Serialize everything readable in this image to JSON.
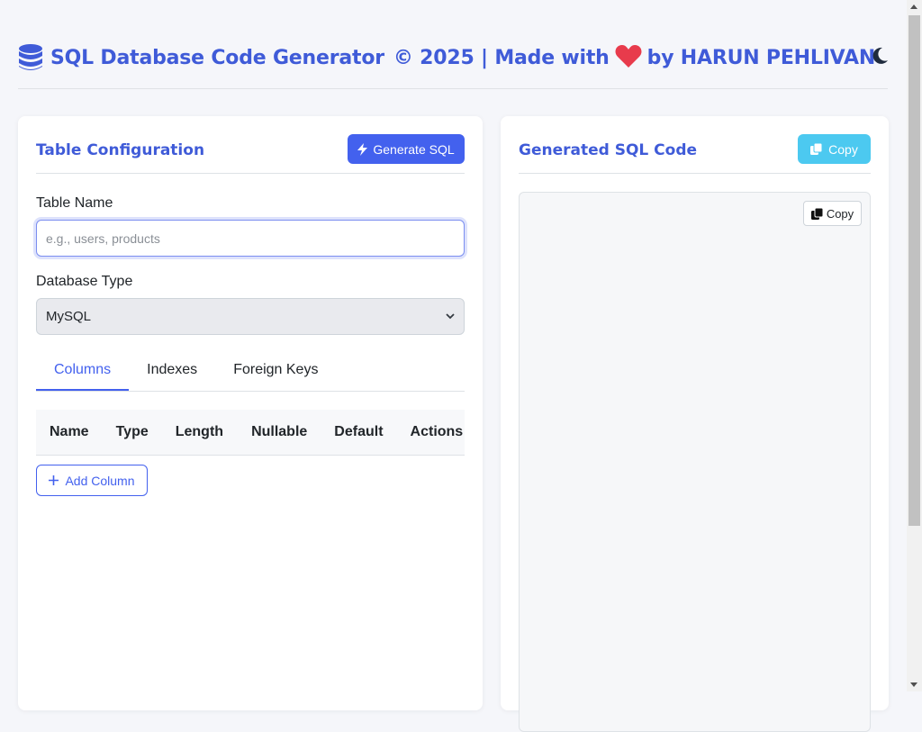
{
  "header": {
    "title_main": "SQL Database Code Generator",
    "title_copyright": "© 2025 | Made with",
    "title_by": "by HARUN PEHLIVAN",
    "icons": {
      "logo": "database-icon",
      "heart": "heart-icon",
      "theme": "moon-icon"
    }
  },
  "left_panel": {
    "title": "Table Configuration",
    "generate_label": "Generate SQL",
    "table_name_label": "Table Name",
    "table_name_value": "",
    "table_name_placeholder": "e.g., users, products",
    "db_type_label": "Database Type",
    "db_type_selected": "MySQL",
    "tabs": [
      {
        "label": "Columns",
        "active": true
      },
      {
        "label": "Indexes",
        "active": false
      },
      {
        "label": "Foreign Keys",
        "active": false
      }
    ],
    "columns_table": {
      "headers": [
        "Name",
        "Type",
        "Length",
        "Nullable",
        "Default",
        "Actions"
      ]
    },
    "add_column_label": "Add Column"
  },
  "right_panel": {
    "title": "Generated SQL Code",
    "copy_label": "Copy",
    "inner_copy_label": "Copy",
    "code": ""
  },
  "colors": {
    "accent": "#4361ee",
    "title_blue": "#3f5bd8",
    "copy_button": "#4cc9f0",
    "heart": "#e83b4c",
    "background": "#f5f6fa"
  }
}
